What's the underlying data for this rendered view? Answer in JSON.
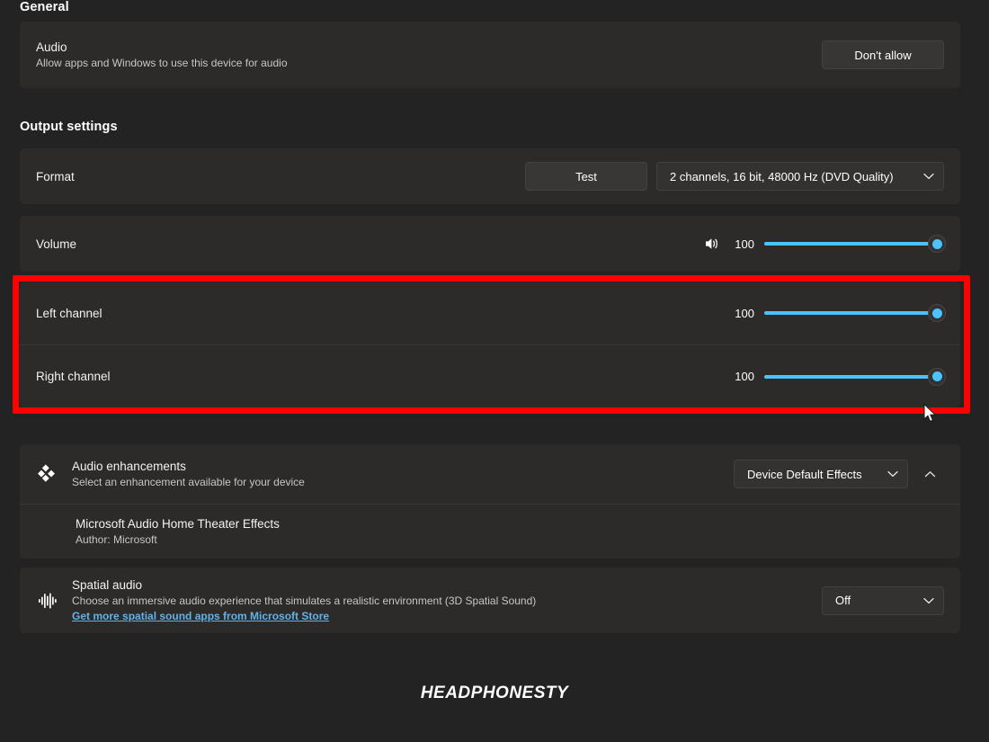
{
  "sections": {
    "general": {
      "title": "General"
    },
    "output": {
      "title": "Output settings"
    }
  },
  "audio_row": {
    "label": "Audio",
    "description": "Allow apps and Windows to use this device for audio",
    "button_label": "Don't allow"
  },
  "format_row": {
    "label": "Format",
    "test_button": "Test",
    "value": "2 channels, 16 bit, 48000 Hz (DVD Quality)",
    "chevron_icon": "chevron-down-icon"
  },
  "volume_row": {
    "label": "Volume",
    "speaker_icon": "speaker-volume-icon",
    "value": "100"
  },
  "left_channel_row": {
    "label": "Left channel",
    "value": "100"
  },
  "right_channel_row": {
    "label": "Right channel",
    "value": "100"
  },
  "audio_enhancements": {
    "label": "Audio enhancements",
    "description": "Select an enhancement available for your device",
    "icon": "diamonds-enhancement-icon",
    "dropdown_value": "Device Default Effects",
    "dropdown_chevron_icon": "chevron-down-icon",
    "expander_icon": "chevron-up-icon",
    "item": {
      "title": "Microsoft Audio Home Theater Effects",
      "author": "Author: Microsoft"
    }
  },
  "spatial_audio": {
    "label": "Spatial audio",
    "description": "Choose an immersive audio experience that simulates a realistic environment (3D Spatial Sound)",
    "link": "Get more spatial sound apps from Microsoft Store",
    "icon": "audio-waveform-icon",
    "dropdown_value": "Off",
    "dropdown_chevron_icon": "chevron-down-icon"
  },
  "annotation": {
    "highlight_color": "#fe0000",
    "cursor_icon": "mouse-pointer-icon"
  },
  "watermark": {
    "text": "HEADPHONESTY"
  },
  "colors": {
    "accent": "#4cc2ff",
    "page_background": "#232323",
    "card_background": "#2d2b29",
    "link": "#62b2e8"
  }
}
